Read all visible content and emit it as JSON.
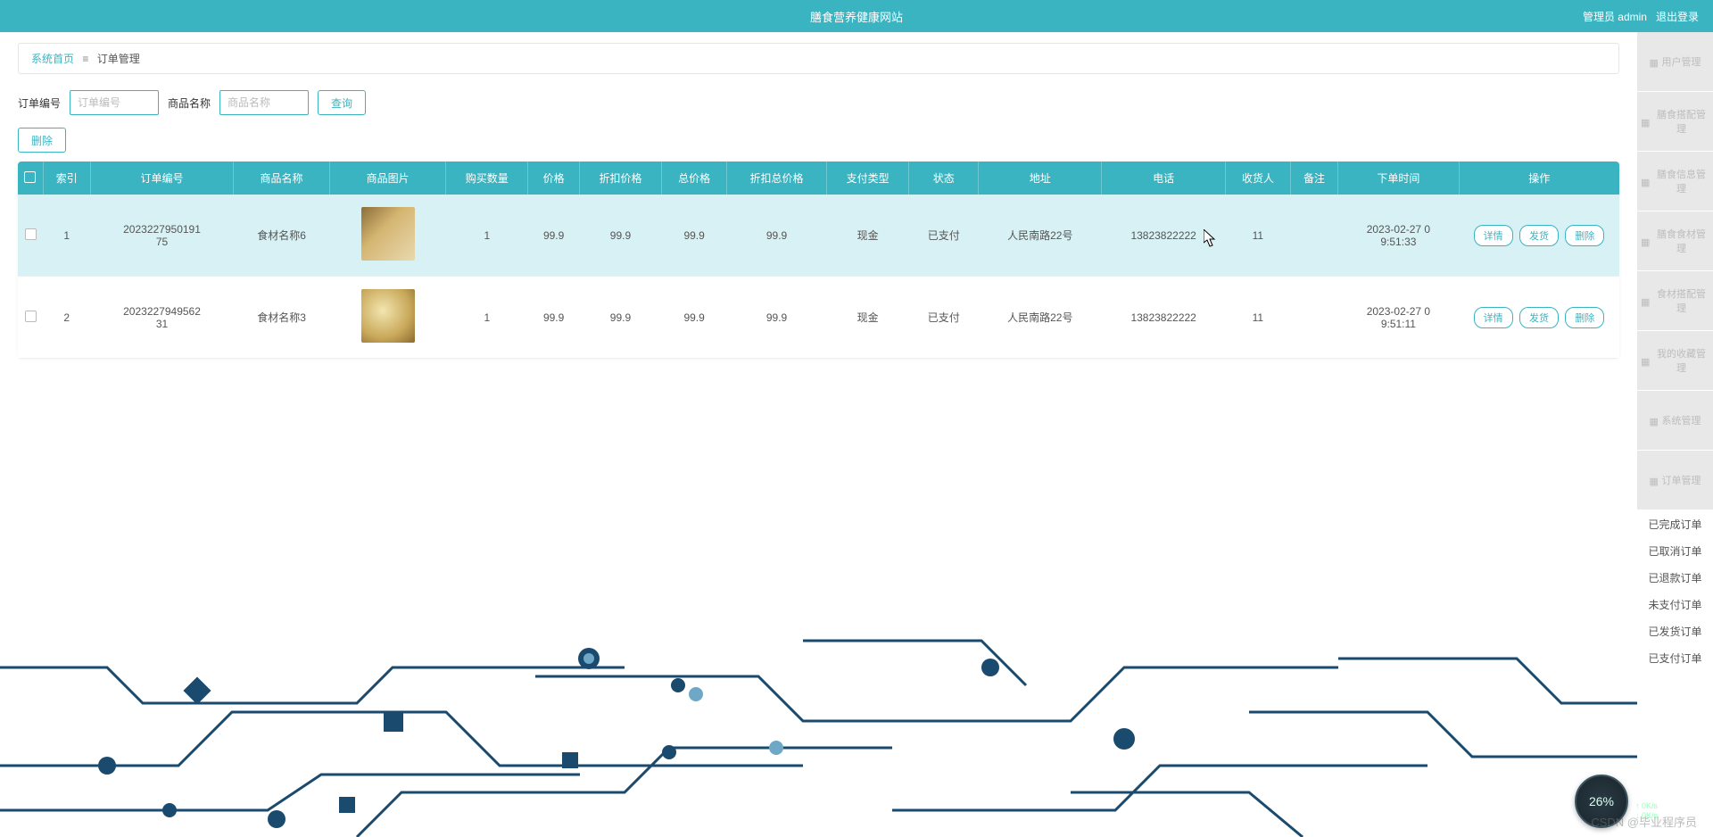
{
  "header": {
    "title": "膳食营养健康网站",
    "admin_label": "管理员 admin",
    "logout": "退出登录"
  },
  "breadcrumb": {
    "home": "系统首页",
    "current": "订单管理"
  },
  "search": {
    "order_no_label": "订单编号",
    "order_no_placeholder": "订单编号",
    "goods_name_label": "商品名称",
    "goods_name_placeholder": "商品名称",
    "query_btn": "查询",
    "delete_btn": "删除"
  },
  "table": {
    "headers": [
      "",
      "索引",
      "订单编号",
      "商品名称",
      "商品图片",
      "购买数量",
      "价格",
      "折扣价格",
      "总价格",
      "折扣总价格",
      "支付类型",
      "状态",
      "地址",
      "电话",
      "收货人",
      "备注",
      "下单时间",
      "操作"
    ],
    "rows": [
      {
        "index": "1",
        "order_no": "2023227950191\n75",
        "goods_name": "食材名称6",
        "qty": "1",
        "price": "99.9",
        "discount_price": "99.9",
        "total": "99.9",
        "discount_total": "99.9",
        "pay_type": "现金",
        "status": "已支付",
        "address": "人民南路22号",
        "phone": "13823822222",
        "receiver": "11",
        "remark": "",
        "order_time": "2023-02-27 0\n9:51:33"
      },
      {
        "index": "2",
        "order_no": "2023227949562\n31",
        "goods_name": "食材名称3",
        "qty": "1",
        "price": "99.9",
        "discount_price": "99.9",
        "total": "99.9",
        "discount_total": "99.9",
        "pay_type": "现金",
        "status": "已支付",
        "address": "人民南路22号",
        "phone": "13823822222",
        "receiver": "11",
        "remark": "",
        "order_time": "2023-02-27 0\n9:51:11"
      }
    ],
    "actions": {
      "detail": "详情",
      "ship": "发货",
      "delete": "删除"
    }
  },
  "sidebar": {
    "items": [
      "用户管理",
      "膳食搭配管理",
      "膳食信息管理",
      "膳食食材管理",
      "食材搭配管理",
      "我的收藏管理",
      "系统管理",
      "订单管理"
    ],
    "sub_items": [
      "已完成订单",
      "已取消订单",
      "已退款订单",
      "未支付订单",
      "已发货订单",
      "已支付订单"
    ]
  },
  "speed": {
    "pct": "26%",
    "up": "0K/s",
    "down": "0K/s"
  },
  "watermark": "CSDN @毕业程序员"
}
